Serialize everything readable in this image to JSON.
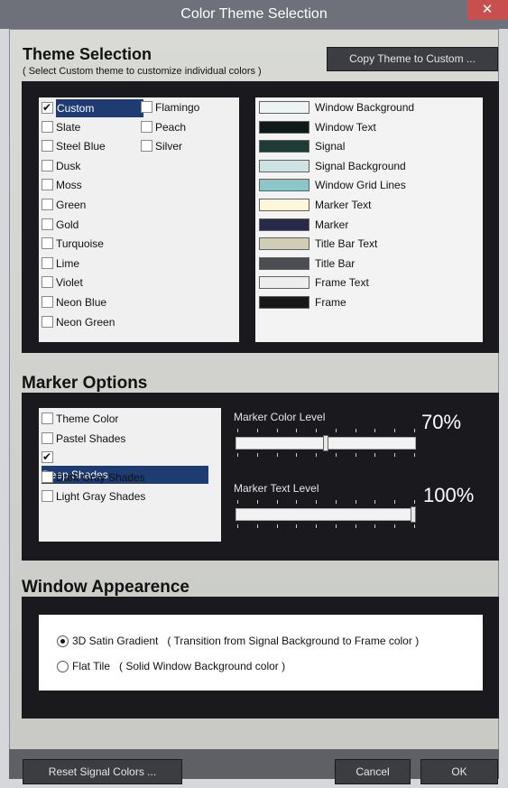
{
  "window": {
    "title": "Color Theme Selection",
    "close_glyph": "✕"
  },
  "theme_selection": {
    "heading": "Theme Selection",
    "subtitle": "( Select Custom theme to customize individual colors )",
    "copy_button": "Copy Theme to Custom ...",
    "themes_col1": [
      {
        "label": "Custom",
        "checked": true,
        "selected": true
      },
      {
        "label": "Slate",
        "checked": false
      },
      {
        "label": "Steel Blue",
        "checked": false
      },
      {
        "label": "Dusk",
        "checked": false
      },
      {
        "label": "Moss",
        "checked": false
      },
      {
        "label": "Green",
        "checked": false
      },
      {
        "label": "Gold",
        "checked": false
      },
      {
        "label": "Turquoise",
        "checked": false
      },
      {
        "label": "Lime",
        "checked": false
      },
      {
        "label": "Violet",
        "checked": false
      },
      {
        "label": "Neon Blue",
        "checked": false
      },
      {
        "label": "Neon Green",
        "checked": false
      }
    ],
    "themes_col2": [
      {
        "label": "Flamingo",
        "checked": false
      },
      {
        "label": "Peach",
        "checked": false
      },
      {
        "label": "Silver",
        "checked": false
      }
    ],
    "colors": [
      {
        "label": "Window Background",
        "color": "#eef3f3"
      },
      {
        "label": "Window Text",
        "color": "#0f1a18"
      },
      {
        "label": "Signal",
        "color": "#1f3b36"
      },
      {
        "label": "Signal Background",
        "color": "#cfe2e2"
      },
      {
        "label": "Window Grid Lines",
        "color": "#8cc6c6"
      },
      {
        "label": "Marker Text",
        "color": "#fbf7d8"
      },
      {
        "label": "Marker",
        "color": "#282a4a"
      },
      {
        "label": "Title Bar Text",
        "color": "#cfcdb6"
      },
      {
        "label": "Title Bar",
        "color": "#4b4d52"
      },
      {
        "label": "Frame Text",
        "color": "#eeeeee"
      },
      {
        "label": "Frame",
        "color": "#17181a"
      }
    ]
  },
  "marker_options": {
    "heading": "Marker Options",
    "items": [
      {
        "label": "Theme Color",
        "checked": false
      },
      {
        "label": "Pastel Shades",
        "checked": false
      },
      {
        "label": "Deep Shades",
        "checked": true,
        "selected": true
      },
      {
        "label": "Dark Gray Shades",
        "checked": false
      },
      {
        "label": "Light Gray Shades",
        "checked": false
      }
    ],
    "color_level": {
      "label": "Marker Color Level",
      "value_text": "70%",
      "value": 0.5
    },
    "text_level": {
      "label": "Marker Text Level",
      "value_text": "100%",
      "value": 1.0
    }
  },
  "window_appearance": {
    "heading": "Window Appearence",
    "options": [
      {
        "label": "3D Satin Gradient",
        "note": "( Transition from Signal Background to Frame color )",
        "selected": true
      },
      {
        "label": "Flat Tile",
        "note": "( Solid Window Background color )",
        "selected": false
      }
    ]
  },
  "footer": {
    "reset_button": "Reset Signal Colors ...",
    "cancel_button": "Cancel",
    "ok_button": "OK"
  }
}
